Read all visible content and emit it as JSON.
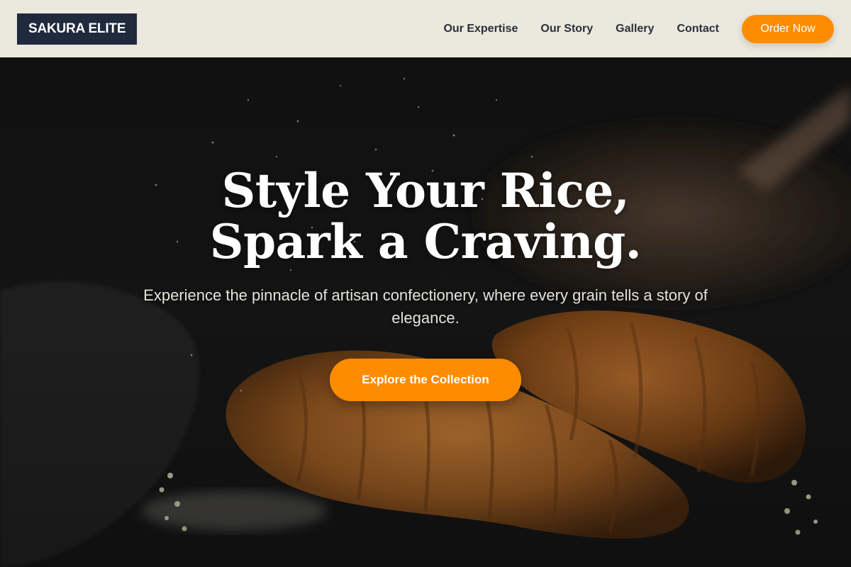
{
  "header": {
    "logo_text": "SAKURA ELITE",
    "nav": [
      {
        "label": "Our Expertise"
      },
      {
        "label": "Our Story"
      },
      {
        "label": "Gallery"
      },
      {
        "label": "Contact"
      }
    ],
    "order_button": "Order Now"
  },
  "hero": {
    "headline_line1": "Style Your Rice,",
    "headline_line2": "Spark a Craving.",
    "subtext": "Experience the pinnacle of artisan confectionery, where every grain tells a story of elegance.",
    "cta_label": "Explore the Collection"
  },
  "colors": {
    "accent": "#ff8c00",
    "header_bg": "#ebe8de",
    "logo_bg": "#1f2a3d"
  }
}
